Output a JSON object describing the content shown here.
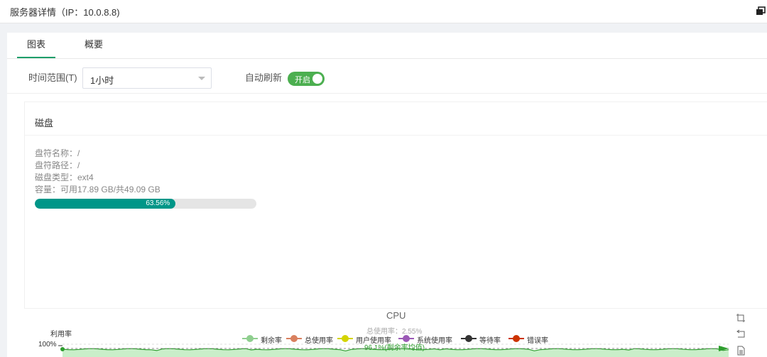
{
  "window": {
    "title": "服务器详情（IP：10.0.8.8)"
  },
  "tabs": [
    {
      "label": "图表",
      "active": true
    },
    {
      "label": "概要",
      "active": false
    }
  ],
  "toolbar": {
    "time_range_label": "时间范围(T)",
    "time_range_value": "1小时",
    "auto_refresh_label": "自动刷新",
    "auto_refresh_toggle_text": "开启",
    "auto_refresh_on": true
  },
  "disk": {
    "title": "磁盘",
    "drive_name": "盘符名称：/",
    "drive_path": "盘符路径：/",
    "disk_type": "磁盘类型：ext4",
    "capacity": "容量：可用17.89 GB/共49.09 GB",
    "usage_percent": 63.56,
    "usage_label": "63.56%"
  },
  "cpu_chart": {
    "title": "CPU",
    "subtitle": "总使用率：2.55%",
    "ylabel": "利用率",
    "ytick_top": "100%",
    "annotation": "96.1%(剩余率均值)",
    "legend": [
      {
        "name": "剩余率",
        "color": "#8fcf8f"
      },
      {
        "name": "总使用率",
        "color": "#d9805f"
      },
      {
        "name": "用户使用率",
        "color": "#d4d400"
      },
      {
        "name": "系统使用率",
        "color": "#9b59b6"
      },
      {
        "name": "等待率",
        "color": "#333333"
      },
      {
        "name": "错误率",
        "color": "#cc3300"
      }
    ],
    "series_color": "#2e9e2e",
    "fill_color": "#c9eec9"
  },
  "chart_data": {
    "type": "line",
    "title": "CPU",
    "subtitle": "总使用率：2.55%",
    "ylabel": "利用率",
    "series": [
      {
        "name": "剩余率",
        "mean": 96.1
      }
    ],
    "ylim": [
      0,
      100
    ]
  },
  "icons": {
    "window_restore": "window-restore-icon",
    "tool_restore": "restore-icon",
    "tool_zoom_back": "zoom-back-icon",
    "tool_data_view": "data-view-icon"
  }
}
